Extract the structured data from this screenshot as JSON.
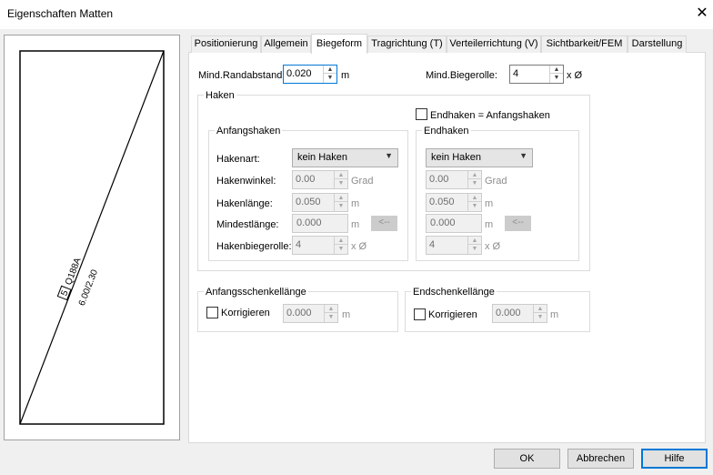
{
  "window": {
    "title": "Eigenschaften Matten"
  },
  "preview": {
    "mesh_type": "Q188A",
    "count": "5",
    "dimensions": "6.00/2.30"
  },
  "tabs": [
    {
      "label": "Positionierung"
    },
    {
      "label": "Allgemein"
    },
    {
      "label": "Biegeform"
    },
    {
      "label": "Tragrichtung (T)"
    },
    {
      "label": "Verteilerrichtung (V)"
    },
    {
      "label": "Sichtbarkeit/FEM"
    },
    {
      "label": "Darstellung"
    }
  ],
  "active_tab": "Biegeform",
  "top_fields": {
    "randabstand_label": "Mind.Randabstand:",
    "randabstand_value": "0.020",
    "randabstand_unit": "m",
    "biegerolle_label": "Mind.Biegerolle:",
    "biegerolle_value": "4",
    "biegerolle_unit": "x Ø"
  },
  "haken": {
    "title": "Haken",
    "same_label": "Endhaken = Anfangshaken",
    "anfang": {
      "title": "Anfangshaken",
      "hakenart_label": "Hakenart:",
      "hakenart_value": "kein Haken",
      "hakenwinkel_label": "Hakenwinkel:",
      "hakenwinkel_value": "0.00",
      "hakenwinkel_unit": "Grad",
      "hakenlaenge_label": "Hakenlänge:",
      "hakenlaenge_value": "0.050",
      "hakenlaenge_unit": "m",
      "mindestlaenge_label": "Mindestlänge:",
      "mindestlaenge_value": "0.000",
      "mindestlaenge_unit": "m",
      "arrow_label": "<--",
      "biegerolle_label": "Hakenbiegerolle:",
      "biegerolle_value": "4",
      "biegerolle_unit": "x Ø"
    },
    "end": {
      "title": "Endhaken",
      "hakenart_value": "kein Haken",
      "hakenwinkel_value": "0.00",
      "hakenwinkel_unit": "Grad",
      "hakenlaenge_value": "0.050",
      "hakenlaenge_unit": "m",
      "mindestlaenge_value": "0.000",
      "mindestlaenge_unit": "m",
      "arrow_label": "<--",
      "biegerolle_value": "4",
      "biegerolle_unit": "x Ø"
    }
  },
  "schenkel": {
    "anfang_title": "Anfangsschenkellänge",
    "end_title": "Endschenkellänge",
    "korrigieren_label": "Korrigieren",
    "anfang_value": "0.000",
    "end_value": "0.000",
    "unit": "m"
  },
  "buttons": {
    "ok": "OK",
    "cancel": "Abbrechen",
    "help": "Hilfe"
  },
  "icons": {
    "close": "close-icon",
    "spin_up": "spin-up-icon",
    "spin_down": "spin-down-icon",
    "dropdown": "chevron-down-icon"
  },
  "colors": {
    "accent": "#0078d7",
    "disabled_text": "#8d8d8d",
    "dialog_bg": "#f0f0f0"
  }
}
